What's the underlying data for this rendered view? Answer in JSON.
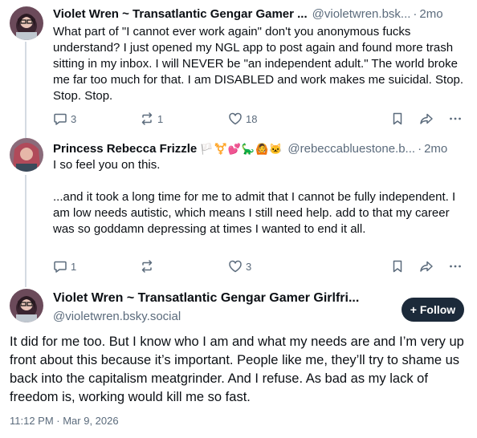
{
  "reply1": {
    "author_name": "Violet Wren ~ Transatlantic Gengar Gamer ...",
    "handle": "@violetwren.bsk...",
    "separator": "·",
    "time": "2mo",
    "text": "What part of \"I cannot ever work again\" don't you anonymous fucks understand? I just opened my NGL app to post again and found more trash sitting in my inbox. I will NEVER be \"an independent adult.\" The world broke me far too much for that. I am DISABLED and work makes me suicidal. Stop. Stop. Stop.",
    "replies": "3",
    "reposts": "1",
    "likes": "18"
  },
  "reply2": {
    "author_name": "Princess Rebecca Frizzle",
    "name_emoji": "🏳️⚧️💕🦕🙆🐱",
    "handle": "@rebeccabluestone.b...",
    "separator": "·",
    "time": "2mo",
    "text": "I so feel you on this.\n\n...and it took a long time for me to admit that I cannot be fully independent. I am low needs autistic, which means I still need help. add to that my career was so goddamn depressing at times I wanted to end it all.",
    "replies": "1",
    "reposts": "",
    "likes": "3"
  },
  "main": {
    "author_name": "Violet Wren ~ Transatlantic Gengar Gamer Girlfri...",
    "handle": "@violetwren.bsky.social",
    "follow_label": "+ Follow",
    "text": "It did for me too. But I know who I am and what my needs are and I’m very up front about this because it’s important. People like me, they’ll try to shame us back into the capitalism meatgrinder. And I refuse. As bad as my lack of freedom is, working would kill me so fast.",
    "timestamp": "11:12 PM · Mar 9, 2026"
  },
  "colors": {
    "muted": "#5b6b7c",
    "follow_bg": "#1c2a3a",
    "thread_line": "#d4dbe2"
  },
  "icons": [
    "avatar",
    "reply-icon",
    "repost-icon",
    "like-icon",
    "bookmark-icon",
    "share-icon",
    "more-icon"
  ]
}
